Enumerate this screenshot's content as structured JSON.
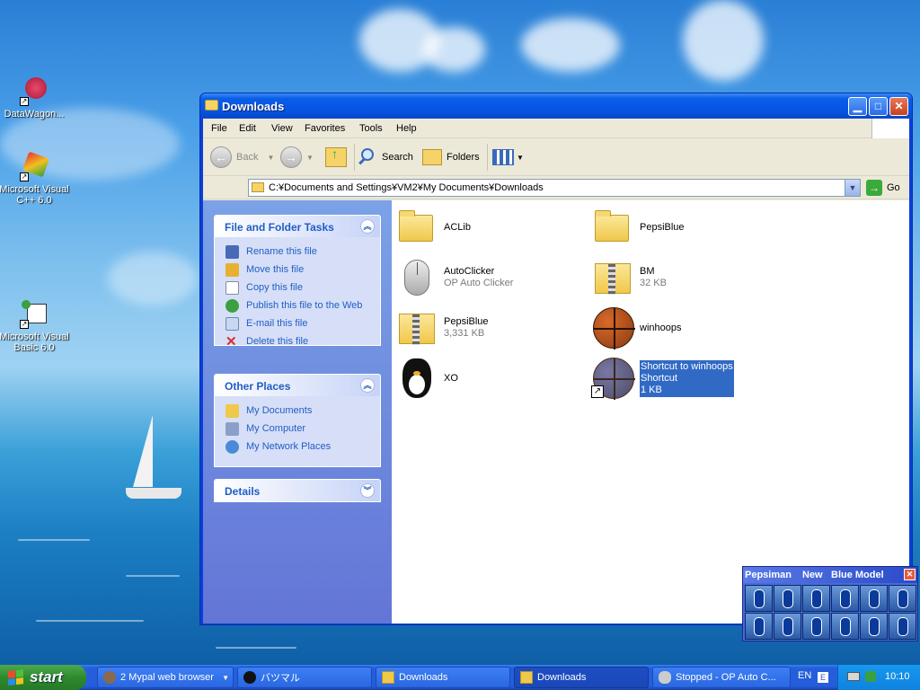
{
  "desktop": {
    "icons": [
      {
        "label": "DataWagon...",
        "icon": "datawagon-icon"
      },
      {
        "label": "Microsoft Visual C++ 6.0",
        "icon": "visual-cpp-icon"
      },
      {
        "label": "Microsoft Visual Basic 6.0",
        "icon": "visual-basic-icon"
      }
    ]
  },
  "window": {
    "title": "Downloads",
    "menu": [
      "File",
      "Edit",
      "View",
      "Favorites",
      "Tools",
      "Help"
    ],
    "toolbar": {
      "back_label": "Back",
      "search_label": "Search",
      "folders_label": "Folders"
    },
    "address": {
      "path": "C:¥Documents and Settings¥VM2¥My Documents¥Downloads",
      "go_label": "Go"
    },
    "taskpane": {
      "file_tasks": {
        "title": "File and Folder Tasks",
        "items": [
          {
            "label": "Rename this file",
            "icon": "rename-icon",
            "color": "#4a6ab8"
          },
          {
            "label": "Move this file",
            "icon": "move-icon",
            "color": "#e8b030"
          },
          {
            "label": "Copy this file",
            "icon": "copy-icon",
            "color": "#d8d8e8"
          },
          {
            "label": "Publish this file to the Web",
            "icon": "globe-icon",
            "color": "#3aa040"
          },
          {
            "label": "E-mail this file",
            "icon": "mail-icon",
            "color": "#c8d8f0"
          },
          {
            "label": "Delete this file",
            "icon": "delete-icon",
            "color": "#d83030"
          }
        ]
      },
      "other_places": {
        "title": "Other Places",
        "items": [
          {
            "label": "My Documents",
            "icon": "folder-icon",
            "color": "#f0c84a"
          },
          {
            "label": "My Computer",
            "icon": "computer-icon",
            "color": "#8aa0c8"
          },
          {
            "label": "My Network Places",
            "icon": "network-icon",
            "color": "#4a8ad8"
          }
        ]
      },
      "details": {
        "title": "Details"
      }
    },
    "files": [
      {
        "name": "ACLib",
        "sub": "",
        "sub2": "",
        "type": "folder"
      },
      {
        "name": "PepsiBlue",
        "sub": "",
        "sub2": "",
        "type": "folder"
      },
      {
        "name": "AutoClicker",
        "sub": "OP Auto Clicker",
        "sub2": "",
        "type": "mouse"
      },
      {
        "name": "BM",
        "sub": "32 KB",
        "sub2": "",
        "type": "zip"
      },
      {
        "name": "PepsiBlue",
        "sub": "3,331 KB",
        "sub2": "",
        "type": "zip"
      },
      {
        "name": "winhoops",
        "sub": "",
        "sub2": "",
        "type": "basketball"
      },
      {
        "name": "XO",
        "sub": "",
        "sub2": "",
        "type": "penguin"
      },
      {
        "name": "Shortcut to winhoops",
        "sub": "Shortcut",
        "sub2": "1 KB",
        "type": "shortcut",
        "selected": true
      }
    ]
  },
  "pepsiman": {
    "title_parts": [
      "Pepsiman",
      "New",
      "Blue Model"
    ]
  },
  "taskbar": {
    "start_label": "start",
    "tasks": [
      {
        "label": "2 Mypal web browser",
        "icon": "mypal-icon"
      },
      {
        "label": "バツマル",
        "icon": "badtz-icon"
      },
      {
        "label": "Downloads",
        "icon": "folder-icon"
      },
      {
        "label": "Downloads",
        "icon": "folder-icon"
      },
      {
        "label": "Stopped - OP Auto C...",
        "icon": "mouse-icon"
      }
    ],
    "language": "EN",
    "clock": "10:10"
  }
}
